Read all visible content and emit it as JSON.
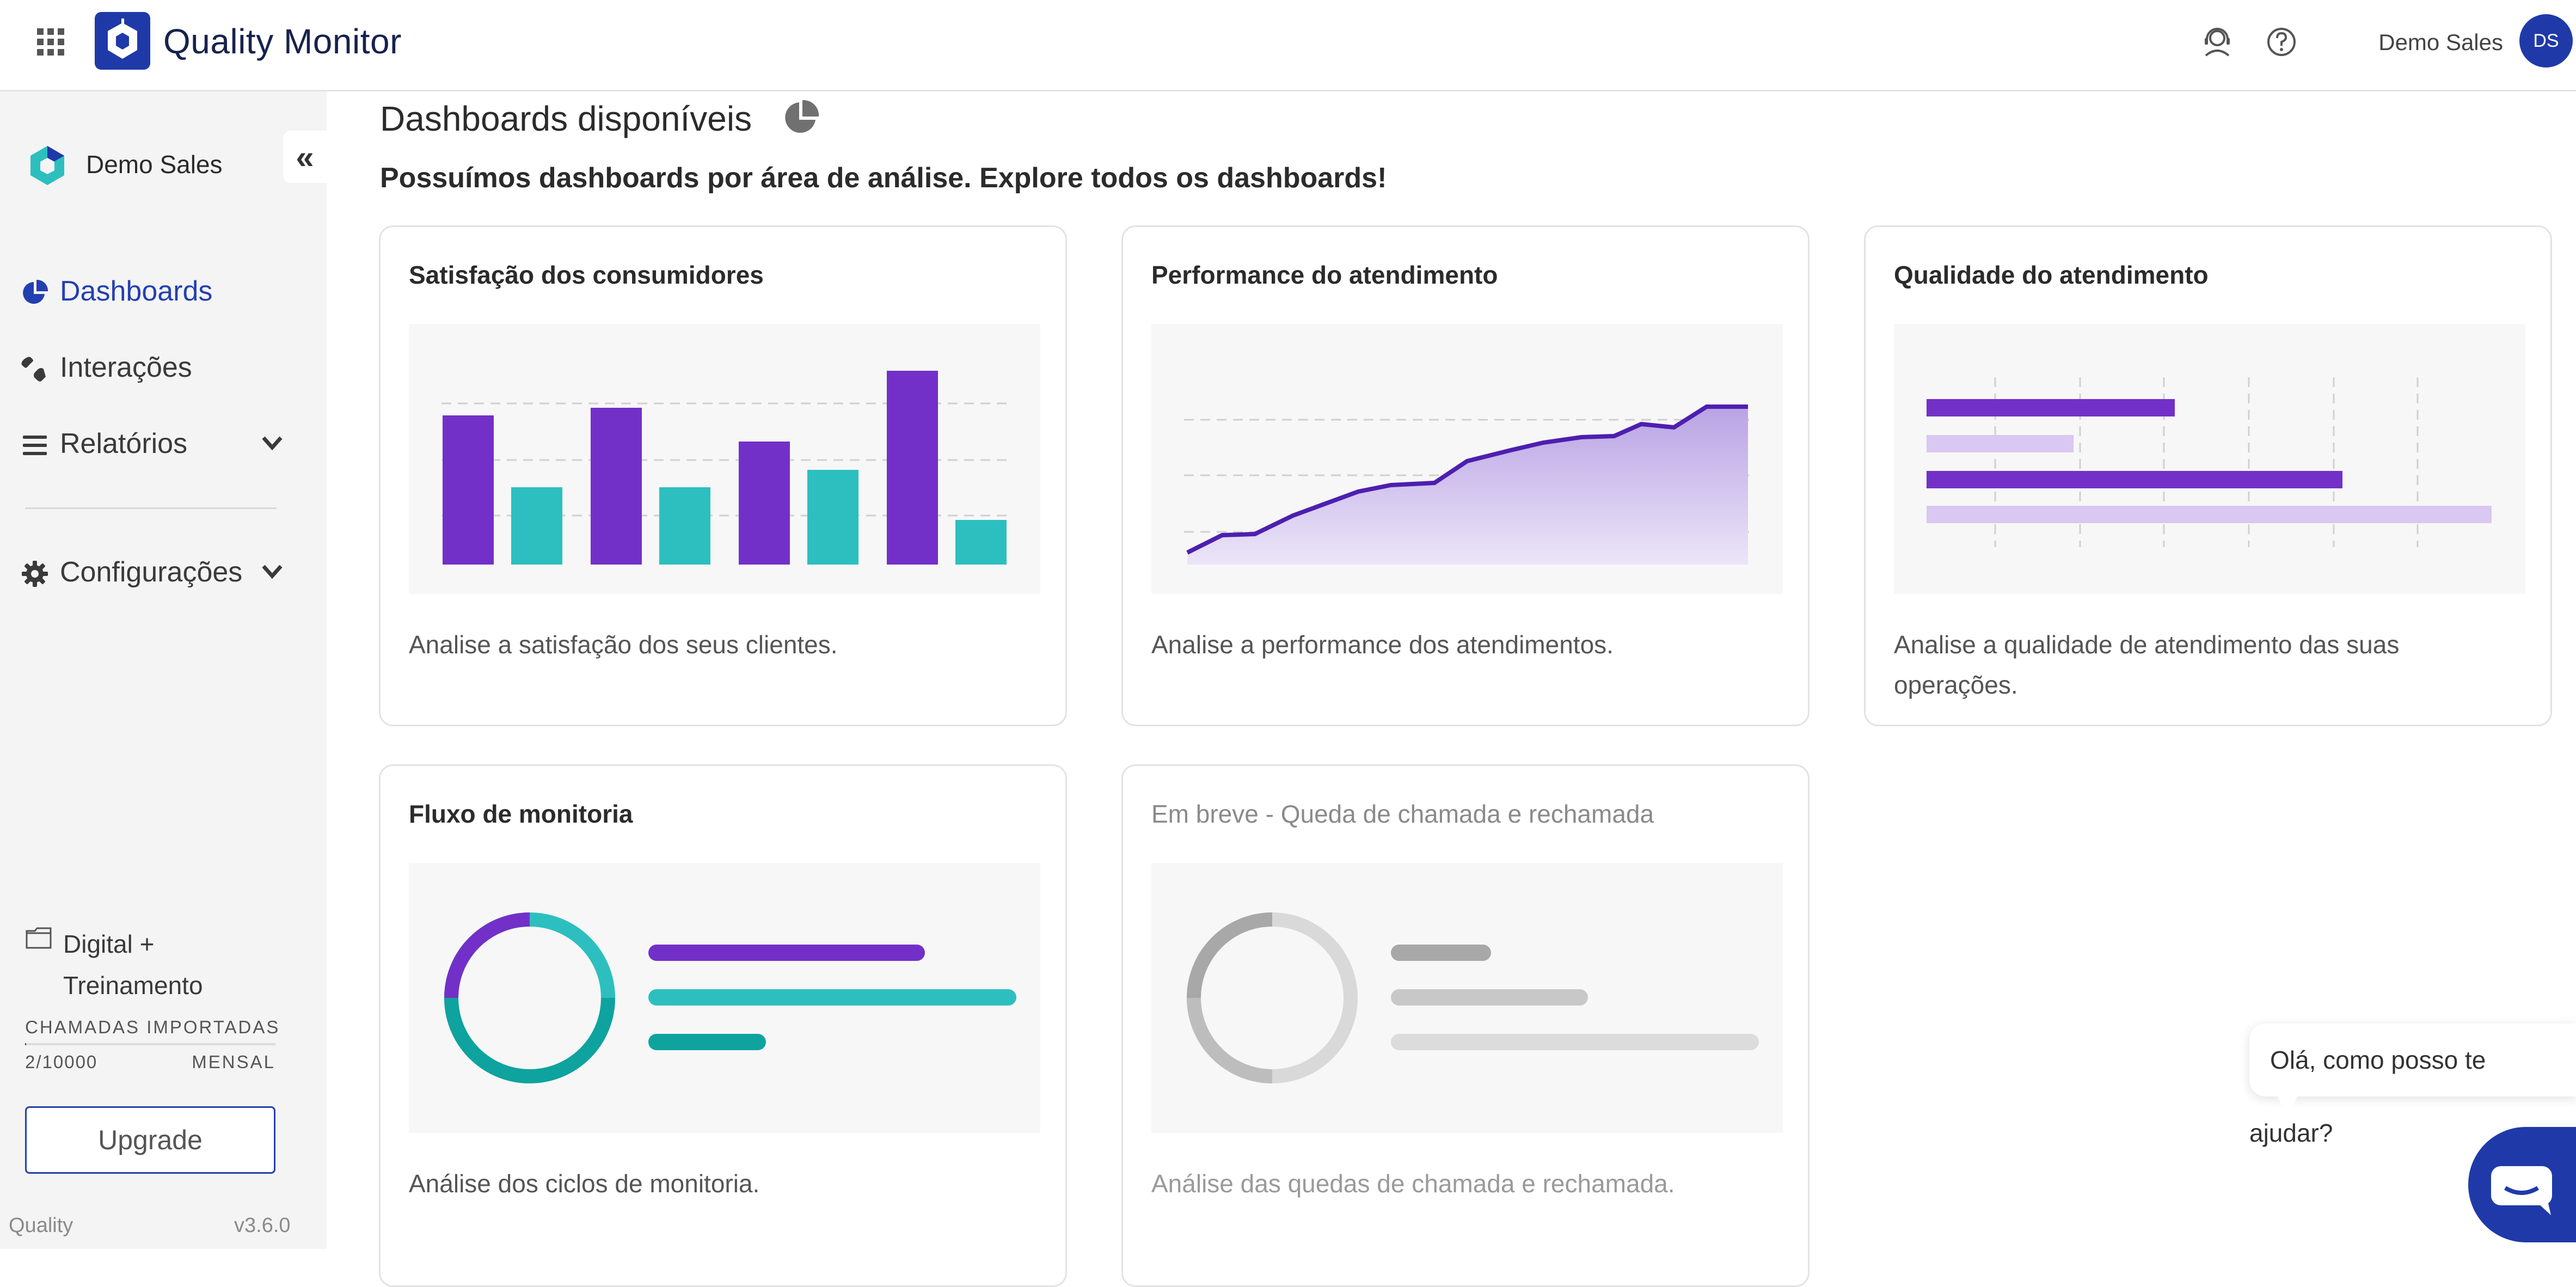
{
  "header": {
    "app_title": "Quality Monitor",
    "user_name": "Demo Sales",
    "avatar_initials": "DS",
    "brand_color": "#1f3aa8"
  },
  "sidebar": {
    "org_name": "Demo Sales",
    "collapse_glyph": "«",
    "nav": [
      {
        "label": "Dashboards",
        "icon": "pie-chart-icon",
        "active": true
      },
      {
        "label": "Interações",
        "icon": "phone-icon"
      },
      {
        "label": "Relatórios",
        "icon": "list-icon",
        "has_submenu": true
      },
      {
        "label": "Configurações",
        "icon": "gear-icon",
        "has_submenu": true
      }
    ],
    "plan": {
      "name": "Digital + Treinamento",
      "usage_label": "CHAMADAS IMPORTADAS",
      "usage_count": "2/10000",
      "usage_fraction": 0.0002,
      "usage_period": "MENSAL",
      "upgrade_label": "Upgrade"
    },
    "footer": {
      "brand": "Quality",
      "version": "v3.6.0"
    }
  },
  "main": {
    "title": "Dashboards disponíveis",
    "subtitle": "Possuímos dashboards por área de análise. Explore todos os dashboards!",
    "cards": [
      {
        "title": "Satisfação dos consumidores",
        "description": "Analise a satisfação dos seus clientes."
      },
      {
        "title": "Performance do atendimento",
        "description": "Analise a performance dos atendimentos."
      },
      {
        "title": "Qualidade do atendimento",
        "description": "Analise a qualidade de atendimento das suas operações."
      },
      {
        "title": "Fluxo de monitoria",
        "description": "Análise dos ciclos de monitoria."
      },
      {
        "title": "Em breve - Queda de chamada e rechamada",
        "description": "Análise das quedas de chamada e rechamada.",
        "disabled": true
      }
    ]
  },
  "chat": {
    "greeting": "Olá, como posso te ajudar?"
  },
  "colors": {
    "purple": "#7330c8",
    "teal": "#2dbfbf",
    "light_purple": "#d9c8f1",
    "dark_teal": "#0ea39e"
  }
}
